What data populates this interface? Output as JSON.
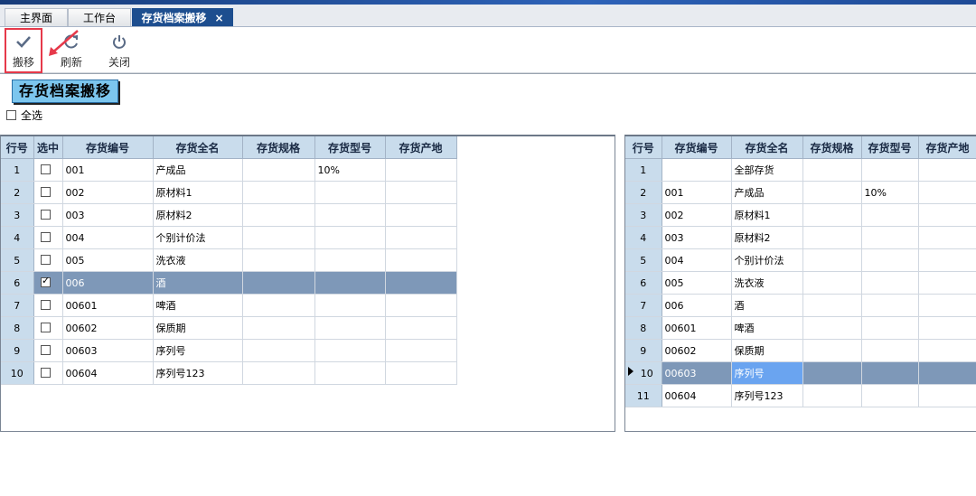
{
  "tabs": [
    {
      "label": "主界面"
    },
    {
      "label": "工作台"
    },
    {
      "label": "存货档案搬移",
      "close": "×"
    }
  ],
  "toolbar": {
    "move_label": "搬移",
    "refresh_label": "刷新",
    "close_label": "关闭"
  },
  "page_title": "存货档案搬移",
  "select_all_label": "全选",
  "left_table": {
    "headers": [
      "行号",
      "选中",
      "存货编号",
      "存货全名",
      "存货规格",
      "存货型号",
      "存货产地"
    ],
    "rows": [
      {
        "n": "1",
        "code": "001",
        "name": "产成品",
        "spec": "",
        "model": "10%",
        "origin": ""
      },
      {
        "n": "2",
        "code": "002",
        "name": "原材料1",
        "spec": "",
        "model": "",
        "origin": ""
      },
      {
        "n": "3",
        "code": "003",
        "name": "原材料2",
        "spec": "",
        "model": "",
        "origin": ""
      },
      {
        "n": "4",
        "code": "004",
        "name": "个别计价法",
        "spec": "",
        "model": "",
        "origin": ""
      },
      {
        "n": "5",
        "code": "005",
        "name": "洗衣液",
        "spec": "",
        "model": "",
        "origin": ""
      },
      {
        "n": "6",
        "code": "006",
        "name": "酒",
        "spec": "",
        "model": "",
        "origin": "",
        "checked": true,
        "selected": true
      },
      {
        "n": "7",
        "code": "00601",
        "name": "啤酒",
        "spec": "",
        "model": "",
        "origin": ""
      },
      {
        "n": "8",
        "code": "00602",
        "name": "保质期",
        "spec": "",
        "model": "",
        "origin": ""
      },
      {
        "n": "9",
        "code": "00603",
        "name": "序列号",
        "spec": "",
        "model": "",
        "origin": ""
      },
      {
        "n": "10",
        "code": "00604",
        "name": "序列号123",
        "spec": "",
        "model": "",
        "origin": ""
      }
    ]
  },
  "right_table": {
    "headers": [
      "行号",
      "存货编号",
      "存货全名",
      "存货规格",
      "存货型号",
      "存货产地"
    ],
    "rows": [
      {
        "n": "1",
        "code": "",
        "name": "全部存货",
        "spec": "",
        "model": "",
        "origin": ""
      },
      {
        "n": "2",
        "code": "001",
        "name": "产成品",
        "spec": "",
        "model": "10%",
        "origin": ""
      },
      {
        "n": "3",
        "code": "002",
        "name": "原材料1",
        "spec": "",
        "model": "",
        "origin": ""
      },
      {
        "n": "4",
        "code": "003",
        "name": "原材料2",
        "spec": "",
        "model": "",
        "origin": ""
      },
      {
        "n": "5",
        "code": "004",
        "name": "个别计价法",
        "spec": "",
        "model": "",
        "origin": ""
      },
      {
        "n": "6",
        "code": "005",
        "name": "洗衣液",
        "spec": "",
        "model": "",
        "origin": ""
      },
      {
        "n": "7",
        "code": "006",
        "name": "酒",
        "spec": "",
        "model": "",
        "origin": ""
      },
      {
        "n": "8",
        "code": "00601",
        "name": "啤酒",
        "spec": "",
        "model": "",
        "origin": ""
      },
      {
        "n": "9",
        "code": "00602",
        "name": "保质期",
        "spec": "",
        "model": "",
        "origin": ""
      },
      {
        "n": "10",
        "code": "00603",
        "name": "序列号",
        "spec": "",
        "model": "",
        "origin": "",
        "current": true
      },
      {
        "n": "11",
        "code": "00604",
        "name": "序列号123",
        "spec": "",
        "model": "",
        "origin": ""
      }
    ]
  },
  "colors": {
    "title_bg": "#7cc6ee",
    "active_tab": "#1d4e8f",
    "highlight_box": "#e6394a",
    "selected_row": "#7e98b8",
    "header_bg": "#c9dcec"
  }
}
